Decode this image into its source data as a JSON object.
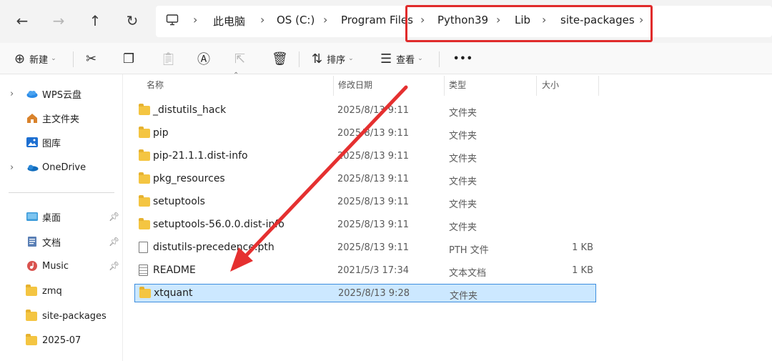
{
  "address_bar": {
    "crumbs": [
      "此电脑",
      "OS (C:)",
      "Program Files",
      "Python39",
      "Lib",
      "site-packages"
    ]
  },
  "toolbar": {
    "new_label": "新建",
    "sort_label": "排序",
    "view_label": "查看",
    "more_label": "•••"
  },
  "sidebar": {
    "items": [
      {
        "label": "WPS云盘",
        "icon": "cloud-icon"
      },
      {
        "label": "主文件夹",
        "icon": "home-icon"
      },
      {
        "label": "图库",
        "icon": "gallery-icon"
      },
      {
        "label": "OneDrive",
        "icon": "onedrive-icon"
      },
      {
        "label": "桌面",
        "icon": "desktop-icon"
      },
      {
        "label": "文档",
        "icon": "documents-icon"
      },
      {
        "label": "Music",
        "icon": "music-icon"
      },
      {
        "label": "zmq",
        "icon": "folder-icon"
      },
      {
        "label": "site-packages",
        "icon": "folder-icon"
      },
      {
        "label": "2025-07",
        "icon": "folder-icon"
      }
    ]
  },
  "columns": {
    "name": "名称",
    "date": "修改日期",
    "type": "类型",
    "size": "大小"
  },
  "files": [
    {
      "name": "_distutils_hack",
      "date": "2025/8/13 9:11",
      "type": "文件夹",
      "size": "",
      "icon": "folder-icon"
    },
    {
      "name": "pip",
      "date": "2025/8/13 9:11",
      "type": "文件夹",
      "size": "",
      "icon": "folder-icon"
    },
    {
      "name": "pip-21.1.1.dist-info",
      "date": "2025/8/13 9:11",
      "type": "文件夹",
      "size": "",
      "icon": "folder-icon"
    },
    {
      "name": "pkg_resources",
      "date": "2025/8/13 9:11",
      "type": "文件夹",
      "size": "",
      "icon": "folder-icon"
    },
    {
      "name": "setuptools",
      "date": "2025/8/13 9:11",
      "type": "文件夹",
      "size": "",
      "icon": "folder-icon"
    },
    {
      "name": "setuptools-56.0.0.dist-info",
      "date": "2025/8/13 9:11",
      "type": "文件夹",
      "size": "",
      "icon": "folder-icon"
    },
    {
      "name": "distutils-precedence.pth",
      "date": "2025/8/13 9:11",
      "type": "PTH 文件",
      "size": "1 KB",
      "icon": "file-icon"
    },
    {
      "name": "README",
      "date": "2021/5/3 17:34",
      "type": "文本文档",
      "size": "1 KB",
      "icon": "text-file-icon"
    },
    {
      "name": "xtquant",
      "date": "2025/8/13 9:28",
      "type": "文件夹",
      "size": "",
      "icon": "folder-icon",
      "selected": true
    }
  ],
  "colors": {
    "highlight_box": "#e02b2b",
    "arrow": "#e53030",
    "selection_bg": "#cce8ff",
    "selection_border": "#3e8ede",
    "folder": "#f4c542"
  }
}
